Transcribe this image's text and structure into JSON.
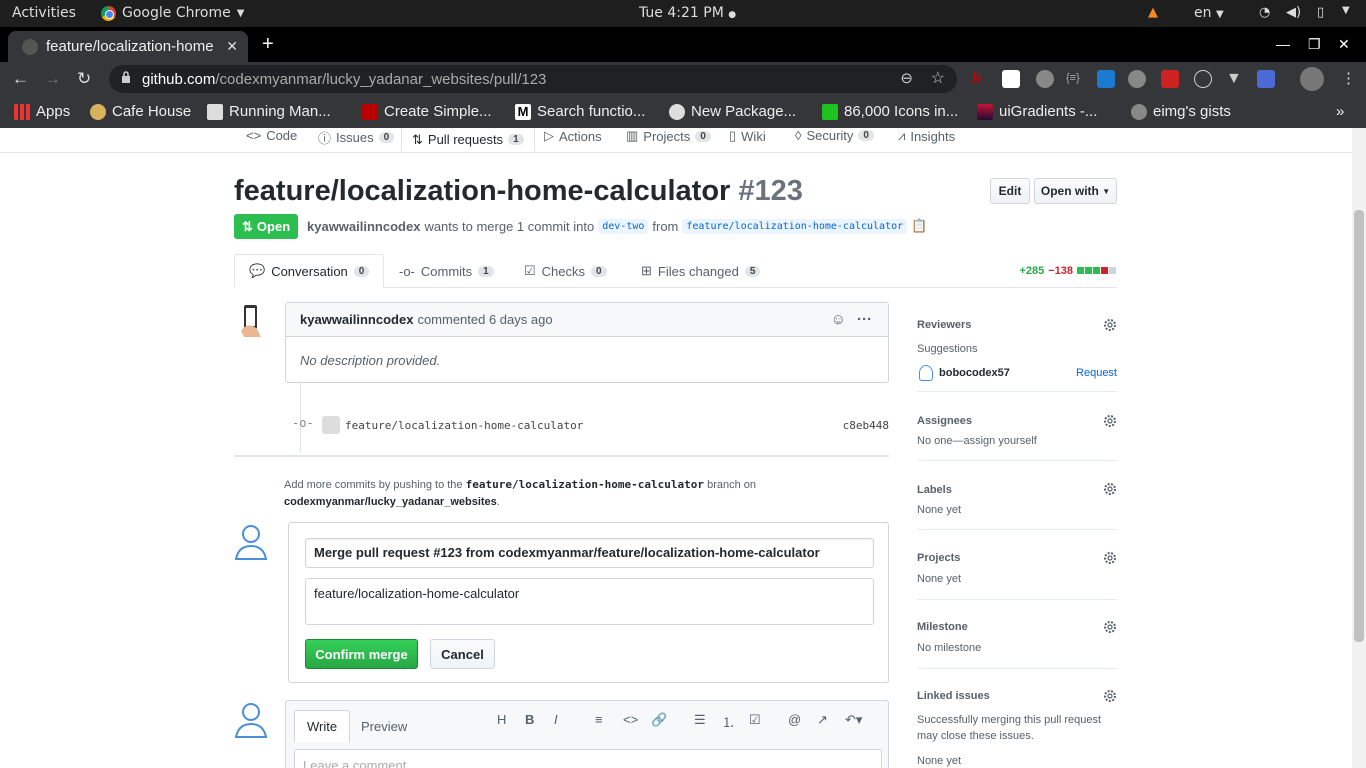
{
  "os": {
    "activities": "Activities",
    "app_name": "Google Chrome",
    "clock": "Tue  4:21 PM",
    "lang": "en"
  },
  "browser": {
    "tab_title": "feature/localization-home-calculator",
    "url_host": "github.com",
    "url_path": "/codexmyanmar/lucky_yadanar_websites/pull/123",
    "bookmarks": [
      "Apps",
      "Cafe House",
      "Running Man...",
      "Create Simple...",
      "Search functio...",
      "New Package...",
      "86,000 Icons in...",
      "uiGradients -...",
      "eimg's gists"
    ]
  },
  "repo_nav": {
    "items": [
      {
        "label": "Code",
        "count": ""
      },
      {
        "label": "Issues",
        "count": "0"
      },
      {
        "label": "Pull requests",
        "count": "1"
      },
      {
        "label": "Actions",
        "count": ""
      },
      {
        "label": "Projects",
        "count": "0"
      },
      {
        "label": "Wiki",
        "count": ""
      },
      {
        "label": "Security",
        "count": "0"
      },
      {
        "label": "Insights",
        "count": ""
      }
    ]
  },
  "pr": {
    "title": "feature/localization-home-calculator",
    "number": "#123",
    "edit_label": "Edit",
    "open_with_label": "Open with",
    "state": "Open",
    "author": "kyawwailinncodex",
    "merge_text": "wants to merge 1 commit into",
    "base_branch": "dev-two",
    "from_text": "from",
    "head_branch": "feature/localization-home-calculator"
  },
  "tabs": [
    {
      "label": "Conversation",
      "count": "0"
    },
    {
      "label": "Commits",
      "count": "1"
    },
    {
      "label": "Checks",
      "count": "0"
    },
    {
      "label": "Files changed",
      "count": "5"
    }
  ],
  "diffstat": {
    "additions": "+285",
    "deletions": "−138"
  },
  "comment": {
    "author": "kyawwailinncodex",
    "action": "commented 6 days ago",
    "body": "No description provided."
  },
  "commit": {
    "message": "feature/localization-home-calculator",
    "sha": "c8eb448"
  },
  "push_note": {
    "prefix": "Add more commits by pushing to the",
    "branch": "feature/localization-home-calculator",
    "mid": "branch on",
    "repo": "codexmyanmar/lucky_yadanar_websites",
    "suffix": "."
  },
  "merge_form": {
    "title_value": "Merge pull request #123 from codexmyanmar/feature/localization-home-calculator",
    "body_value": "feature/localization-home-calculator",
    "confirm_label": "Confirm merge",
    "cancel_label": "Cancel"
  },
  "writer": {
    "write_tab": "Write",
    "preview_tab": "Preview",
    "placeholder": "Leave a comment"
  },
  "sidebar": {
    "reviewers_heading": "Reviewers",
    "suggestions_label": "Suggestions",
    "suggested_reviewer": "bobocodex57",
    "request_label": "Request",
    "assignees_heading": "Assignees",
    "assignees_value": "No one—assign yourself",
    "labels_heading": "Labels",
    "labels_value": "None yet",
    "projects_heading": "Projects",
    "projects_value": "None yet",
    "milestone_heading": "Milestone",
    "milestone_value": "No milestone",
    "linked_heading": "Linked issues",
    "linked_value": "Successfully merging this pull request may close these issues.",
    "linked_none": "None yet"
  },
  "colors": {
    "accent_green": "#2cbe4e",
    "link_blue": "#0366d6",
    "tab_orange": "#e36209"
  }
}
